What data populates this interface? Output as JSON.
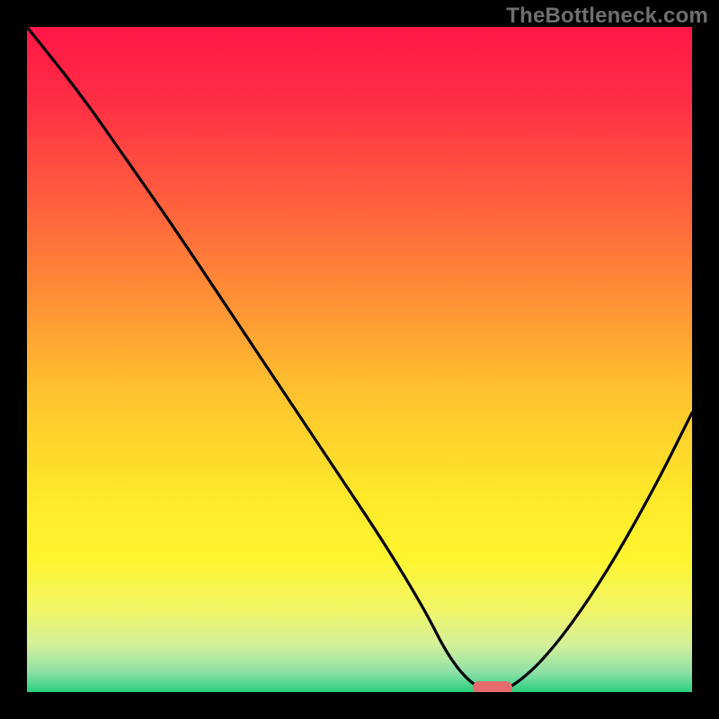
{
  "attribution": "TheBottleneck.com",
  "chart_data": {
    "type": "line",
    "title": "",
    "xlabel": "",
    "ylabel": "",
    "xlim": [
      0,
      100
    ],
    "ylim": [
      0,
      100
    ],
    "series": [
      {
        "name": "bottleneck-curve",
        "x": [
          0,
          8,
          15,
          22,
          30,
          38,
          46,
          54,
          60,
          63,
          66,
          69,
          72,
          78,
          86,
          94,
          100
        ],
        "y": [
          100,
          90,
          80,
          70,
          58,
          46,
          34,
          22,
          12,
          6,
          2,
          0,
          0,
          5,
          16,
          30,
          42
        ]
      }
    ],
    "marker": {
      "x_start": 67,
      "x_end": 73,
      "y": 0
    },
    "gradient_stops": [
      {
        "offset": 0.0,
        "color": "#ff1747"
      },
      {
        "offset": 0.1,
        "color": "#ff2b46"
      },
      {
        "offset": 0.25,
        "color": "#ff5a3e"
      },
      {
        "offset": 0.4,
        "color": "#ff8d36"
      },
      {
        "offset": 0.55,
        "color": "#ffc32e"
      },
      {
        "offset": 0.7,
        "color": "#ffe72a"
      },
      {
        "offset": 0.8,
        "color": "#fff52e"
      },
      {
        "offset": 0.88,
        "color": "#f0f56a"
      },
      {
        "offset": 0.93,
        "color": "#d2f09a"
      },
      {
        "offset": 0.97,
        "color": "#8ee0a7"
      },
      {
        "offset": 1.0,
        "color": "#27d07e"
      }
    ]
  }
}
